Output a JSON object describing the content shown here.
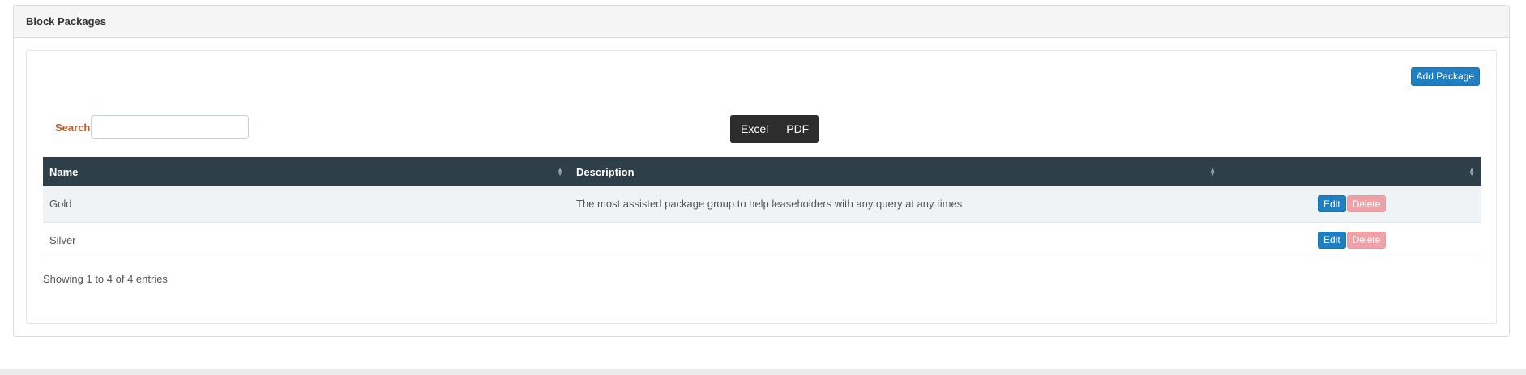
{
  "panel": {
    "title": "Block Packages"
  },
  "toolbar": {
    "add_label": "Add Package"
  },
  "search": {
    "label": "Search",
    "value": "",
    "placeholder": ""
  },
  "export": {
    "excel_label": "Excel",
    "pdf_label": "PDF"
  },
  "table": {
    "columns": [
      "Name",
      "Description",
      ""
    ],
    "rows": [
      {
        "name": "Gold",
        "description": "The most assisted package group to help leaseholders with any query at any times",
        "edit": "Edit",
        "delete": "Delete"
      },
      {
        "name": "Silver",
        "description": "",
        "edit": "Edit",
        "delete": "Delete"
      }
    ]
  },
  "info": "Showing 1 to 4 of 4 entries",
  "colors": {
    "header_bg": "#2e3f4a",
    "primary": "#1e7fc2",
    "danger_light": "#f0a1a8",
    "search_label": "#c25b1e"
  }
}
